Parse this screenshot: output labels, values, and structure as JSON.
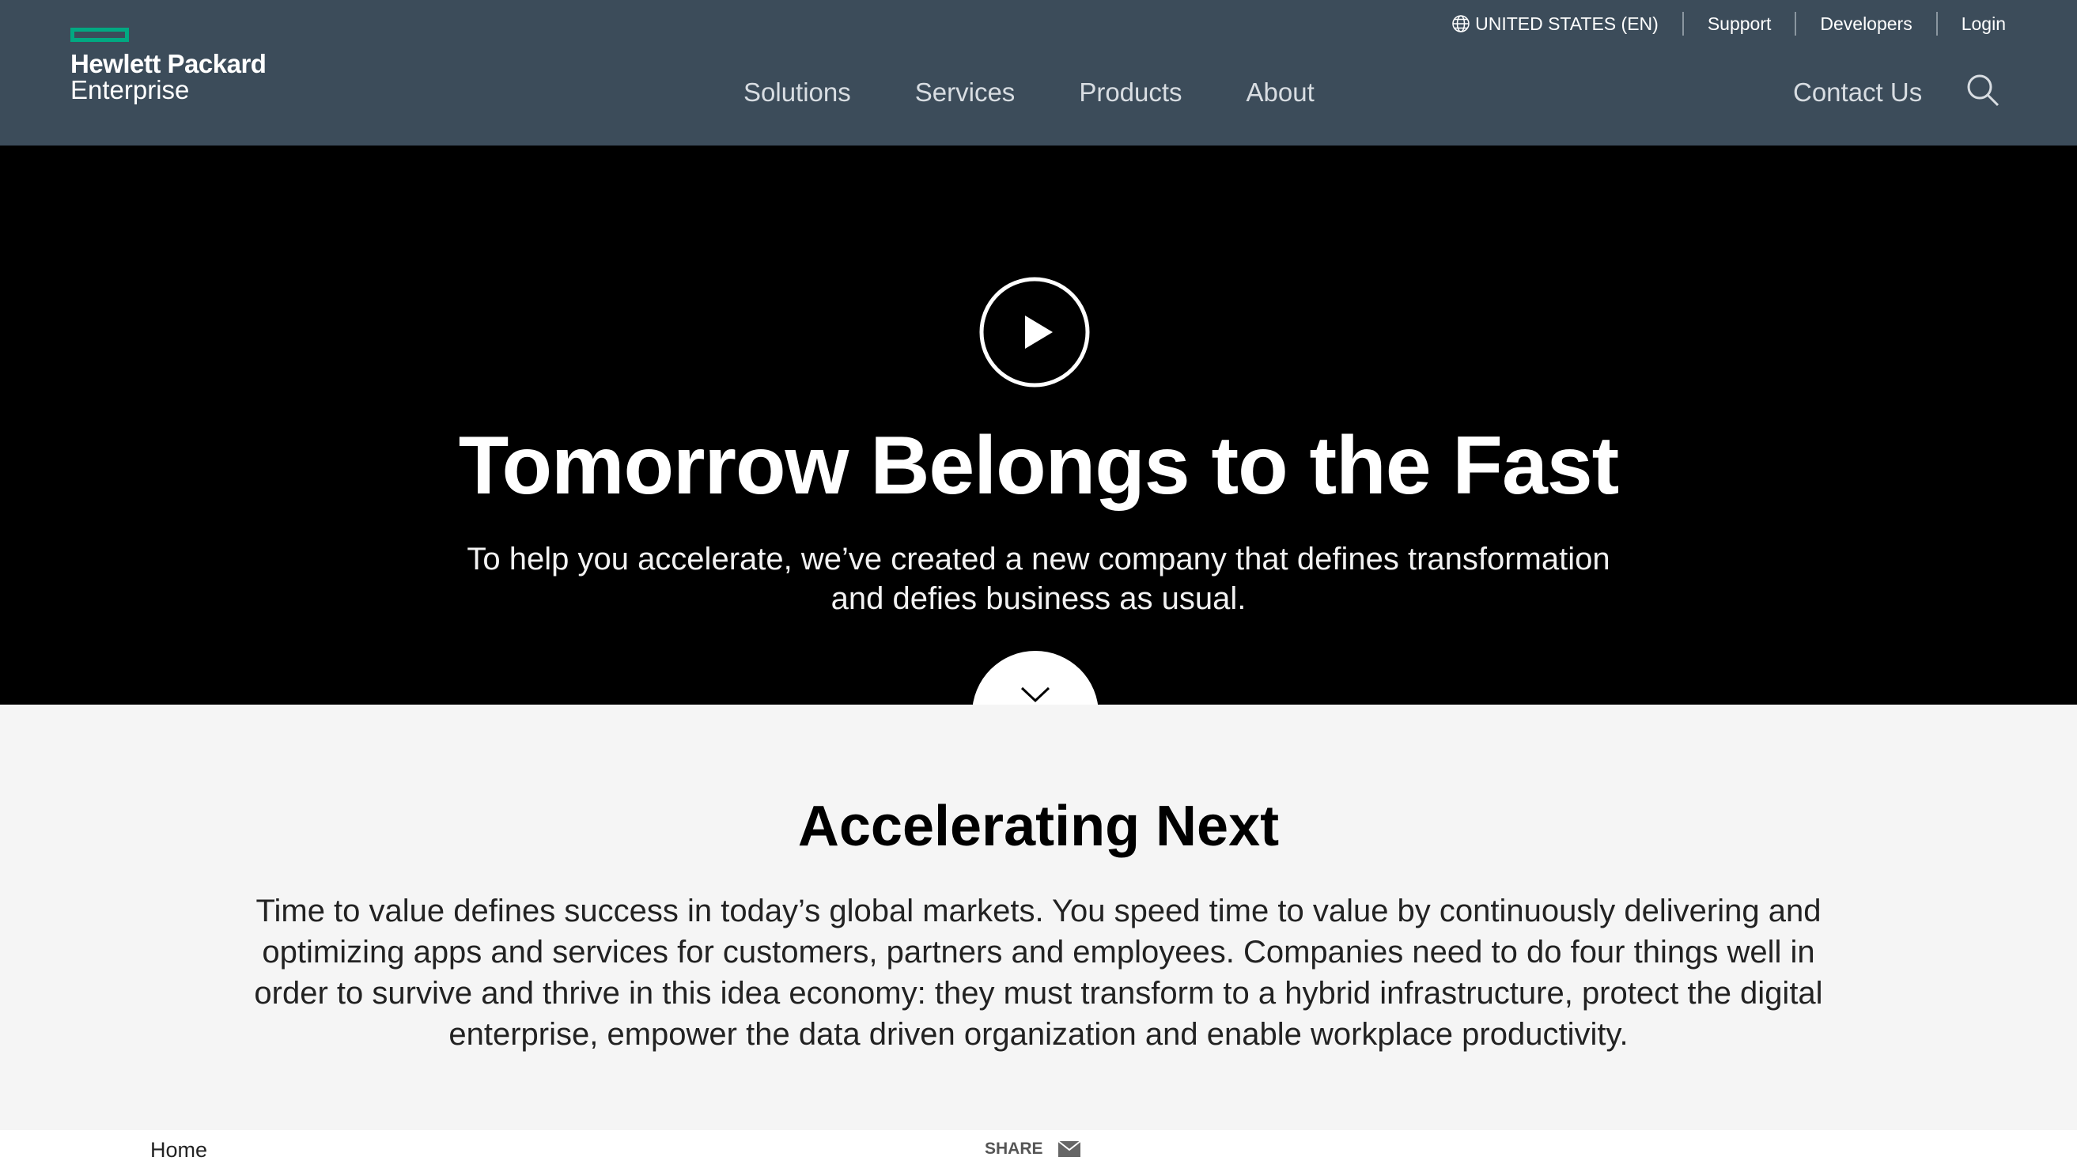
{
  "header": {
    "logo": {
      "line1": "Hewlett Packard",
      "line2": "Enterprise",
      "accent_color": "#01a982"
    },
    "utility_nav": [
      {
        "label": "UNITED STATES (EN)",
        "icon": "globe-icon"
      },
      {
        "label": "Support"
      },
      {
        "label": "Developers"
      },
      {
        "label": "Login"
      }
    ],
    "main_nav": [
      "Solutions",
      "Services",
      "Products",
      "About"
    ],
    "contact_label": "Contact Us",
    "search_icon": "search-icon",
    "background_color": "#3c4c5a"
  },
  "hero": {
    "title": "Tomorrow Belongs to the Fast",
    "subtitle": "To help you accelerate, we’ve created a new company that defines transformation and defies business as usual.",
    "play_icon": "play-icon",
    "scroll_icon": "chevron-down-icon"
  },
  "section": {
    "title": "Accelerating Next",
    "body": "Time to value defines success in today’s global markets. You speed time to value by continuously delivering and optimizing apps and services for customers, partners and employees. Companies need to do four things well in order to survive and thrive in this idea economy: they must transform to a hybrid infrastructure, protect the digital enterprise, empower the data driven organization and enable workplace productivity."
  },
  "footer_bar": {
    "breadcrumb": "Home",
    "share_label": "SHARE",
    "share_icon": "mail-icon"
  }
}
